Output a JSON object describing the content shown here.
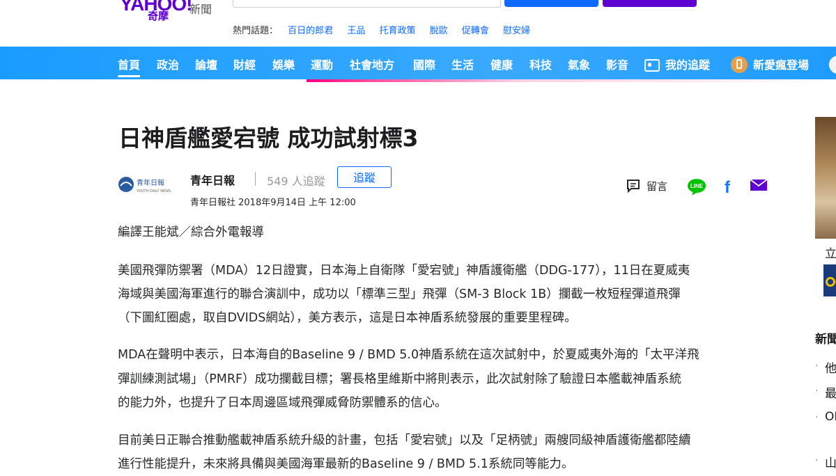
{
  "header": {
    "logo_text": "YAHOO!",
    "logo_sub": "奇摩",
    "section": "新聞",
    "hot_topics_label": "熱門話題：",
    "hot_topics": [
      "百日的郎君",
      "王品",
      "托育政策",
      "脫歐",
      "促轉會",
      "慰安婦"
    ]
  },
  "nav": {
    "items": [
      "首頁",
      "政治",
      "論壇",
      "財經",
      "娛樂",
      "運動",
      "社會地方",
      "國際",
      "生活",
      "健康",
      "科技",
      "氣象",
      "影音"
    ],
    "my_follow": "我的追蹤",
    "promo": "新愛瘋登場"
  },
  "article": {
    "title": "日神盾艦愛宕號 成功試射標3",
    "publisher": "青年日報",
    "followers": "549 人追蹤",
    "follow_label": "追蹤",
    "byline_meta": "青年日報社 2018年9月14日 上午 12:00",
    "author": "編譯王能斌／綜合外電報導",
    "paragraphs": [
      "美國飛彈防禦署（MDA）12日證實，日本海上自衛隊「愛宕號」神盾護衛艦（DDG-177），11日在夏威夷",
      "海域與美國海軍進行的聯合演訓中，成功以「標準三型」飛彈（SM-3 Block 1B）攔截一枚短程彈道飛彈",
      "（下圖紅圈處，取自DVIDS網站），美方表示，這是日本神盾系統發展的重要里程碑。",
      "MDA在聲明中表示，日本海自的Baseline 9 / BMD 5.0神盾系統在這次試射中，於夏威夷外海的「太平洋飛",
      "彈訓練測試場」（PMRF）成功攔截目標；署長格里維斯中將則表示，此次試射除了驗證日本艦載神盾系統",
      "的能力外，也提升了日本周邊區域飛彈威脅防禦體系的信心。",
      "目前美日正聯合推動艦載神盾系統升級的計畫，包括「愛宕號」以及「足柄號」兩艘同級神盾護衛艦都陸續",
      "進行性能提升，未來將具備與美國海軍最新的Baseline 9 / BMD 5.1系統同等能力。"
    ]
  },
  "share": {
    "comment_label": "留言",
    "line_label": "LINE",
    "facebook_label": "f"
  },
  "sidebar": {
    "chars": [
      "立",
      "新聞",
      "他",
      "最",
      "OE",
      "山"
    ]
  },
  "colors": {
    "nav_bg": "#1a9cff",
    "brand_purple": "#6001d2",
    "link_blue": "#0f69ff",
    "line_green": "#00c300",
    "facebook_blue": "#1877f2",
    "mail_purple": "#5f01d1"
  }
}
